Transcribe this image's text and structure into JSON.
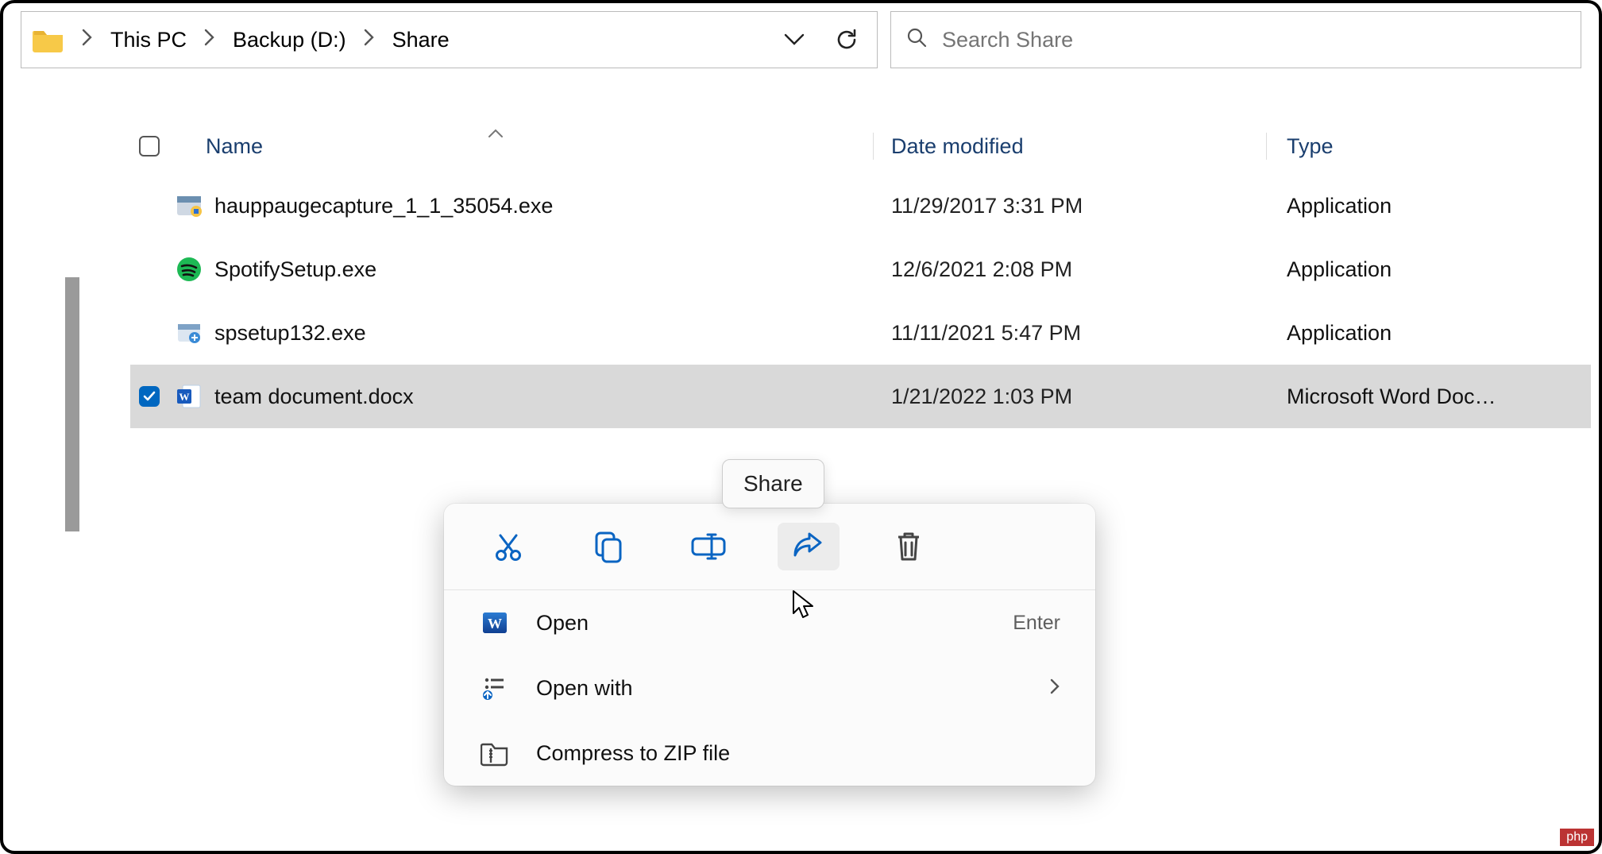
{
  "breadcrumb": {
    "items": [
      "This PC",
      "Backup (D:)",
      "Share"
    ]
  },
  "search": {
    "placeholder": "Search Share"
  },
  "columns": {
    "name": "Name",
    "date": "Date modified",
    "type": "Type"
  },
  "files": [
    {
      "name": "hauppaugecapture_1_1_35054.exe",
      "date": "11/29/2017 3:31 PM",
      "type": "Application",
      "icon": "installer",
      "selected": false
    },
    {
      "name": "SpotifySetup.exe",
      "date": "12/6/2021 2:08 PM",
      "type": "Application",
      "icon": "spotify",
      "selected": false
    },
    {
      "name": "spsetup132.exe",
      "date": "11/11/2021 5:47 PM",
      "type": "Application",
      "icon": "exe",
      "selected": false
    },
    {
      "name": "team document.docx",
      "date": "1/21/2022 1:03 PM",
      "type": "Microsoft Word Doc…",
      "icon": "word",
      "selected": true
    }
  ],
  "context_menu": {
    "icons": [
      "cut",
      "copy",
      "rename",
      "share",
      "delete"
    ],
    "hovered_icon_index": 3,
    "items": [
      {
        "icon": "word",
        "label": "Open",
        "shortcut": "Enter",
        "submenu": false
      },
      {
        "icon": "openwith",
        "label": "Open with",
        "shortcut": "",
        "submenu": true
      },
      {
        "icon": "zip",
        "label": "Compress to ZIP file",
        "shortcut": "",
        "submenu": false
      }
    ]
  },
  "tooltip": {
    "text": "Share"
  },
  "watermark": "php"
}
